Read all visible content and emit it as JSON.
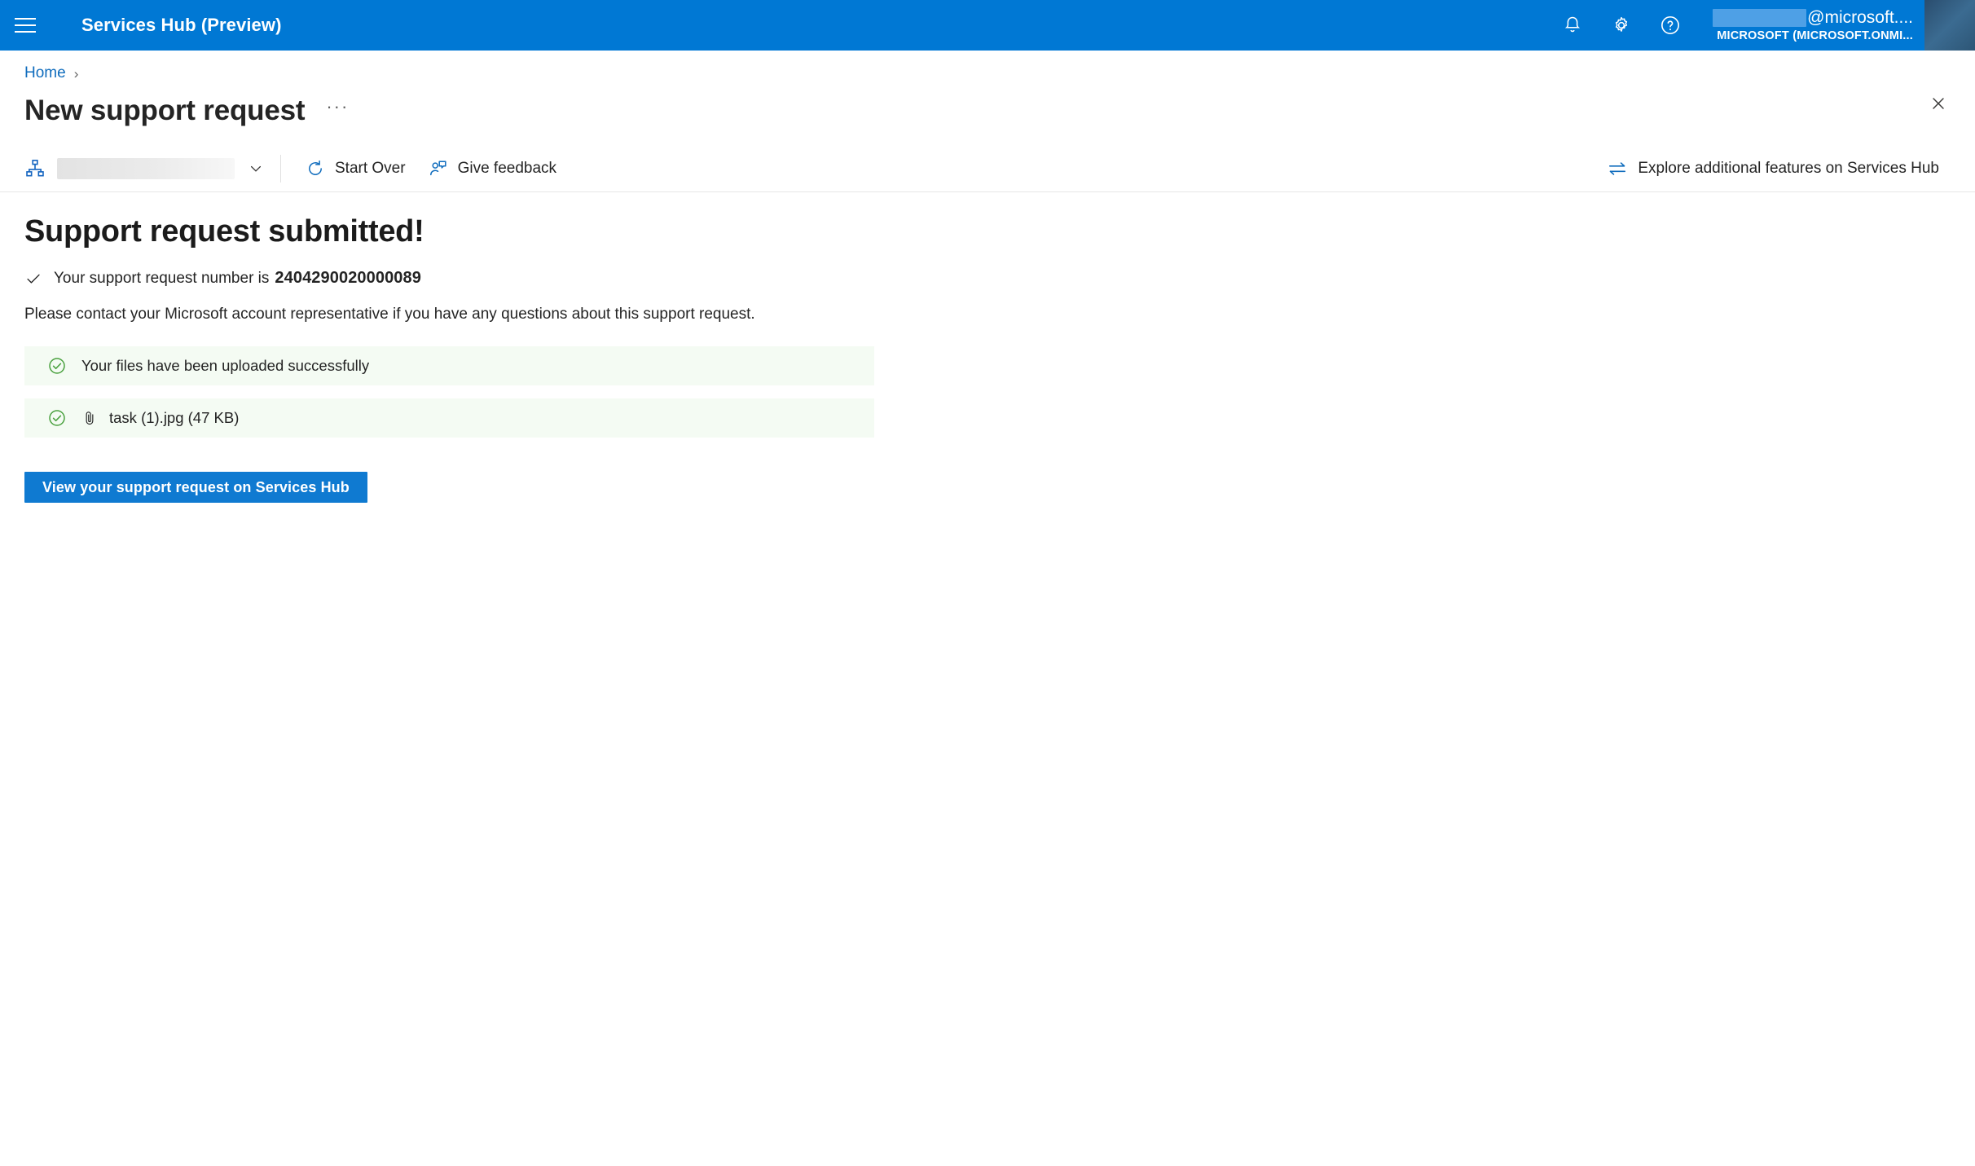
{
  "appbar": {
    "menu_label": "menu",
    "title": "Services Hub (Preview)",
    "icons": {
      "notifications": "bell-icon",
      "settings": "gear-icon",
      "help": "help-circle-icon"
    },
    "account": {
      "email_suffix": "@microsoft....",
      "org": "MICROSOFT (MICROSOFT.ONMI..."
    },
    "brand_color": "#0078d4"
  },
  "breadcrumb": {
    "home": "Home",
    "separator": "›"
  },
  "page": {
    "title": "New support request",
    "more_label": "···",
    "close_label": "Close"
  },
  "commandbar": {
    "selector_icon": "sitemap-icon",
    "selector_value": "",
    "start_over": "Start Over",
    "give_feedback": "Give feedback",
    "explore": "Explore additional features on Services Hub"
  },
  "main": {
    "heading": "Support request submitted!",
    "request_label": "Your support request number is",
    "request_number": "2404290020000089",
    "contact_note": "Please contact your Microsoft account representative if you have any questions about this support request.",
    "banners": [
      {
        "text": "Your files have been uploaded successfully",
        "has_attachment": false
      },
      {
        "text": "task (1).jpg (47 KB)",
        "has_attachment": true
      }
    ],
    "primary_button": "View your support request on Services Hub",
    "success_bg": "#f4fbf3",
    "success_color": "#107c10",
    "button_color": "#0f7ad1"
  }
}
